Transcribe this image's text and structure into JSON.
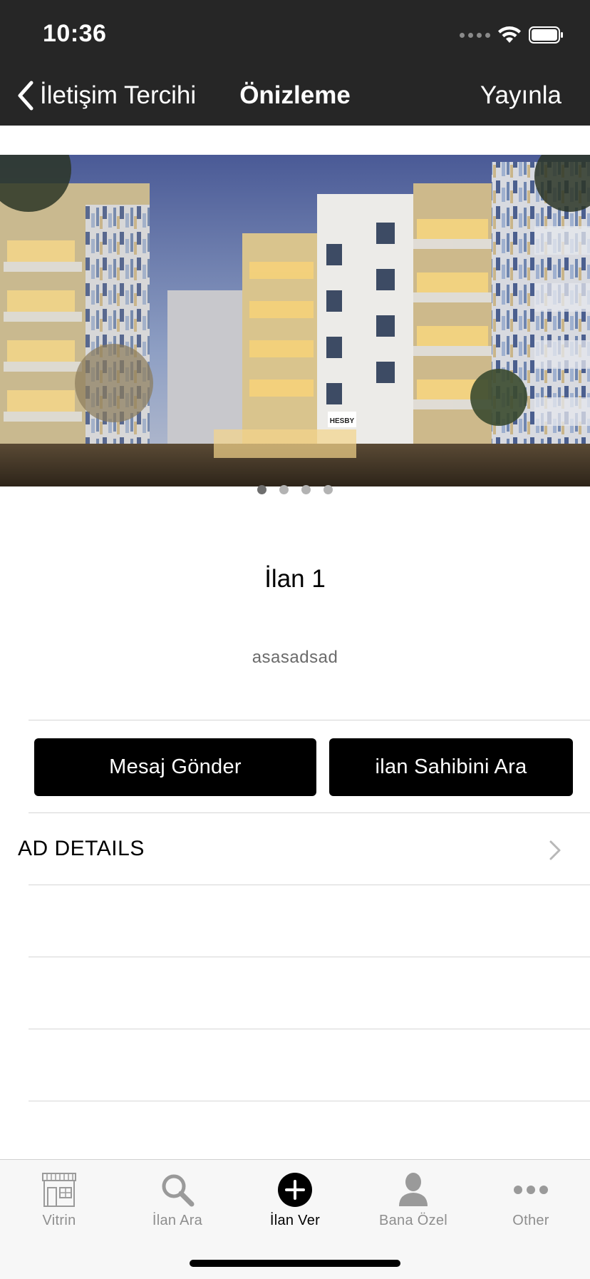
{
  "status_bar": {
    "time": "10:36"
  },
  "nav": {
    "back_label": "İletişim Tercihi",
    "title": "Önizleme",
    "action_label": "Yayınla"
  },
  "gallery": {
    "page_count": 4,
    "current_page": 1,
    "building_sign": "HESBY"
  },
  "ad": {
    "title": "İlan 1",
    "description": "asasadsad"
  },
  "actions": {
    "message_label": "Mesaj Gönder",
    "call_label": "ilan Sahibini Ara"
  },
  "details": {
    "label": "AD DETAILS"
  },
  "tab_bar": {
    "tabs": [
      {
        "label": "Vitrin",
        "icon": "storefront-icon",
        "active": false
      },
      {
        "label": "İlan Ara",
        "icon": "search-icon",
        "active": false
      },
      {
        "label": "İlan Ver",
        "icon": "add-circle-icon",
        "active": true
      },
      {
        "label": "Bana Özel",
        "icon": "person-icon",
        "active": false
      },
      {
        "label": "Other",
        "icon": "more-icon",
        "active": false
      }
    ]
  },
  "colors": {
    "bar_background": "#262626",
    "button_background": "#000000",
    "tab_inactive": "#8e8e8e"
  }
}
